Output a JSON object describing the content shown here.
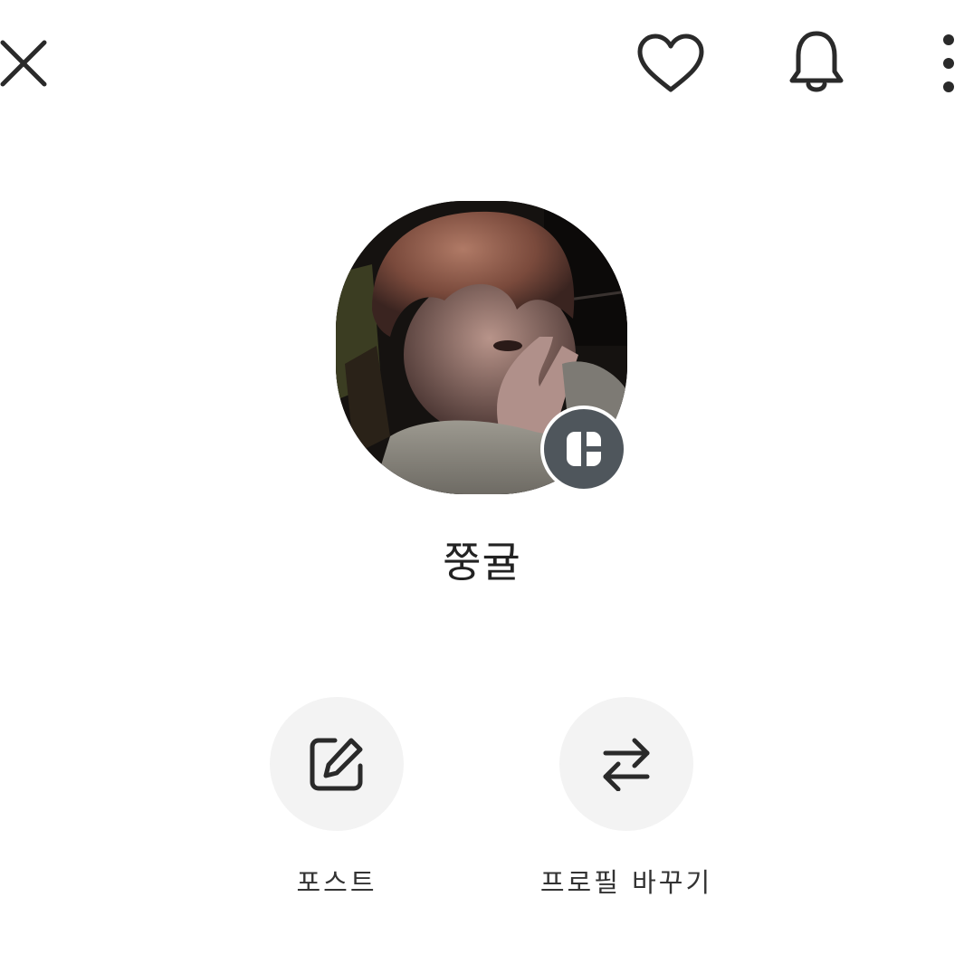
{
  "header": {
    "close_icon": "close-icon",
    "like_icon": "heart-icon",
    "notification_icon": "bell-icon",
    "more_icon": "more-vertical-icon"
  },
  "profile": {
    "name": "쭝귤",
    "avatar": "profile-photo",
    "badge_icon": "layout-icon"
  },
  "actions": [
    {
      "label": "포스트",
      "icon": "edit-icon"
    },
    {
      "label": "프로필 바꾸기",
      "icon": "swap-icon"
    }
  ],
  "colors": {
    "icon": "#2a2a2a",
    "badge": "#4f565c",
    "action_bg": "#f3f3f3",
    "text": "#222222"
  }
}
